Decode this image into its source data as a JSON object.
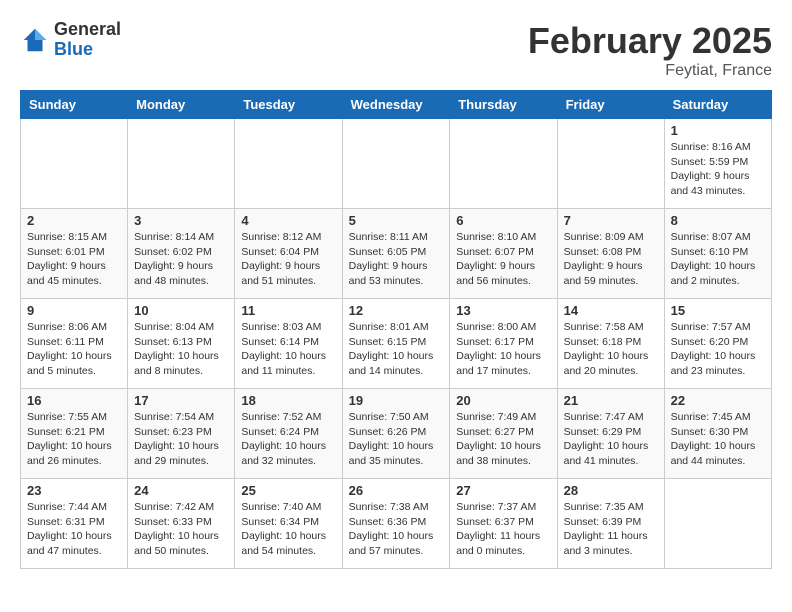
{
  "header": {
    "logo_general": "General",
    "logo_blue": "Blue",
    "month_year": "February 2025",
    "location": "Feytiat, France"
  },
  "days_of_week": [
    "Sunday",
    "Monday",
    "Tuesday",
    "Wednesday",
    "Thursday",
    "Friday",
    "Saturday"
  ],
  "weeks": [
    {
      "cells": [
        {
          "empty": true
        },
        {
          "empty": true
        },
        {
          "empty": true
        },
        {
          "empty": true
        },
        {
          "empty": true
        },
        {
          "empty": true
        },
        {
          "day": "1",
          "sunrise": "Sunrise: 8:16 AM",
          "sunset": "Sunset: 5:59 PM",
          "daylight": "Daylight: 9 hours and 43 minutes."
        }
      ]
    },
    {
      "cells": [
        {
          "day": "2",
          "sunrise": "Sunrise: 8:15 AM",
          "sunset": "Sunset: 6:01 PM",
          "daylight": "Daylight: 9 hours and 45 minutes."
        },
        {
          "day": "3",
          "sunrise": "Sunrise: 8:14 AM",
          "sunset": "Sunset: 6:02 PM",
          "daylight": "Daylight: 9 hours and 48 minutes."
        },
        {
          "day": "4",
          "sunrise": "Sunrise: 8:12 AM",
          "sunset": "Sunset: 6:04 PM",
          "daylight": "Daylight: 9 hours and 51 minutes."
        },
        {
          "day": "5",
          "sunrise": "Sunrise: 8:11 AM",
          "sunset": "Sunset: 6:05 PM",
          "daylight": "Daylight: 9 hours and 53 minutes."
        },
        {
          "day": "6",
          "sunrise": "Sunrise: 8:10 AM",
          "sunset": "Sunset: 6:07 PM",
          "daylight": "Daylight: 9 hours and 56 minutes."
        },
        {
          "day": "7",
          "sunrise": "Sunrise: 8:09 AM",
          "sunset": "Sunset: 6:08 PM",
          "daylight": "Daylight: 9 hours and 59 minutes."
        },
        {
          "day": "8",
          "sunrise": "Sunrise: 8:07 AM",
          "sunset": "Sunset: 6:10 PM",
          "daylight": "Daylight: 10 hours and 2 minutes."
        }
      ]
    },
    {
      "cells": [
        {
          "day": "9",
          "sunrise": "Sunrise: 8:06 AM",
          "sunset": "Sunset: 6:11 PM",
          "daylight": "Daylight: 10 hours and 5 minutes."
        },
        {
          "day": "10",
          "sunrise": "Sunrise: 8:04 AM",
          "sunset": "Sunset: 6:13 PM",
          "daylight": "Daylight: 10 hours and 8 minutes."
        },
        {
          "day": "11",
          "sunrise": "Sunrise: 8:03 AM",
          "sunset": "Sunset: 6:14 PM",
          "daylight": "Daylight: 10 hours and 11 minutes."
        },
        {
          "day": "12",
          "sunrise": "Sunrise: 8:01 AM",
          "sunset": "Sunset: 6:15 PM",
          "daylight": "Daylight: 10 hours and 14 minutes."
        },
        {
          "day": "13",
          "sunrise": "Sunrise: 8:00 AM",
          "sunset": "Sunset: 6:17 PM",
          "daylight": "Daylight: 10 hours and 17 minutes."
        },
        {
          "day": "14",
          "sunrise": "Sunrise: 7:58 AM",
          "sunset": "Sunset: 6:18 PM",
          "daylight": "Daylight: 10 hours and 20 minutes."
        },
        {
          "day": "15",
          "sunrise": "Sunrise: 7:57 AM",
          "sunset": "Sunset: 6:20 PM",
          "daylight": "Daylight: 10 hours and 23 minutes."
        }
      ]
    },
    {
      "cells": [
        {
          "day": "16",
          "sunrise": "Sunrise: 7:55 AM",
          "sunset": "Sunset: 6:21 PM",
          "daylight": "Daylight: 10 hours and 26 minutes."
        },
        {
          "day": "17",
          "sunrise": "Sunrise: 7:54 AM",
          "sunset": "Sunset: 6:23 PM",
          "daylight": "Daylight: 10 hours and 29 minutes."
        },
        {
          "day": "18",
          "sunrise": "Sunrise: 7:52 AM",
          "sunset": "Sunset: 6:24 PM",
          "daylight": "Daylight: 10 hours and 32 minutes."
        },
        {
          "day": "19",
          "sunrise": "Sunrise: 7:50 AM",
          "sunset": "Sunset: 6:26 PM",
          "daylight": "Daylight: 10 hours and 35 minutes."
        },
        {
          "day": "20",
          "sunrise": "Sunrise: 7:49 AM",
          "sunset": "Sunset: 6:27 PM",
          "daylight": "Daylight: 10 hours and 38 minutes."
        },
        {
          "day": "21",
          "sunrise": "Sunrise: 7:47 AM",
          "sunset": "Sunset: 6:29 PM",
          "daylight": "Daylight: 10 hours and 41 minutes."
        },
        {
          "day": "22",
          "sunrise": "Sunrise: 7:45 AM",
          "sunset": "Sunset: 6:30 PM",
          "daylight": "Daylight: 10 hours and 44 minutes."
        }
      ]
    },
    {
      "cells": [
        {
          "day": "23",
          "sunrise": "Sunrise: 7:44 AM",
          "sunset": "Sunset: 6:31 PM",
          "daylight": "Daylight: 10 hours and 47 minutes."
        },
        {
          "day": "24",
          "sunrise": "Sunrise: 7:42 AM",
          "sunset": "Sunset: 6:33 PM",
          "daylight": "Daylight: 10 hours and 50 minutes."
        },
        {
          "day": "25",
          "sunrise": "Sunrise: 7:40 AM",
          "sunset": "Sunset: 6:34 PM",
          "daylight": "Daylight: 10 hours and 54 minutes."
        },
        {
          "day": "26",
          "sunrise": "Sunrise: 7:38 AM",
          "sunset": "Sunset: 6:36 PM",
          "daylight": "Daylight: 10 hours and 57 minutes."
        },
        {
          "day": "27",
          "sunrise": "Sunrise: 7:37 AM",
          "sunset": "Sunset: 6:37 PM",
          "daylight": "Daylight: 11 hours and 0 minutes."
        },
        {
          "day": "28",
          "sunrise": "Sunrise: 7:35 AM",
          "sunset": "Sunset: 6:39 PM",
          "daylight": "Daylight: 11 hours and 3 minutes."
        },
        {
          "empty": true
        }
      ]
    }
  ]
}
